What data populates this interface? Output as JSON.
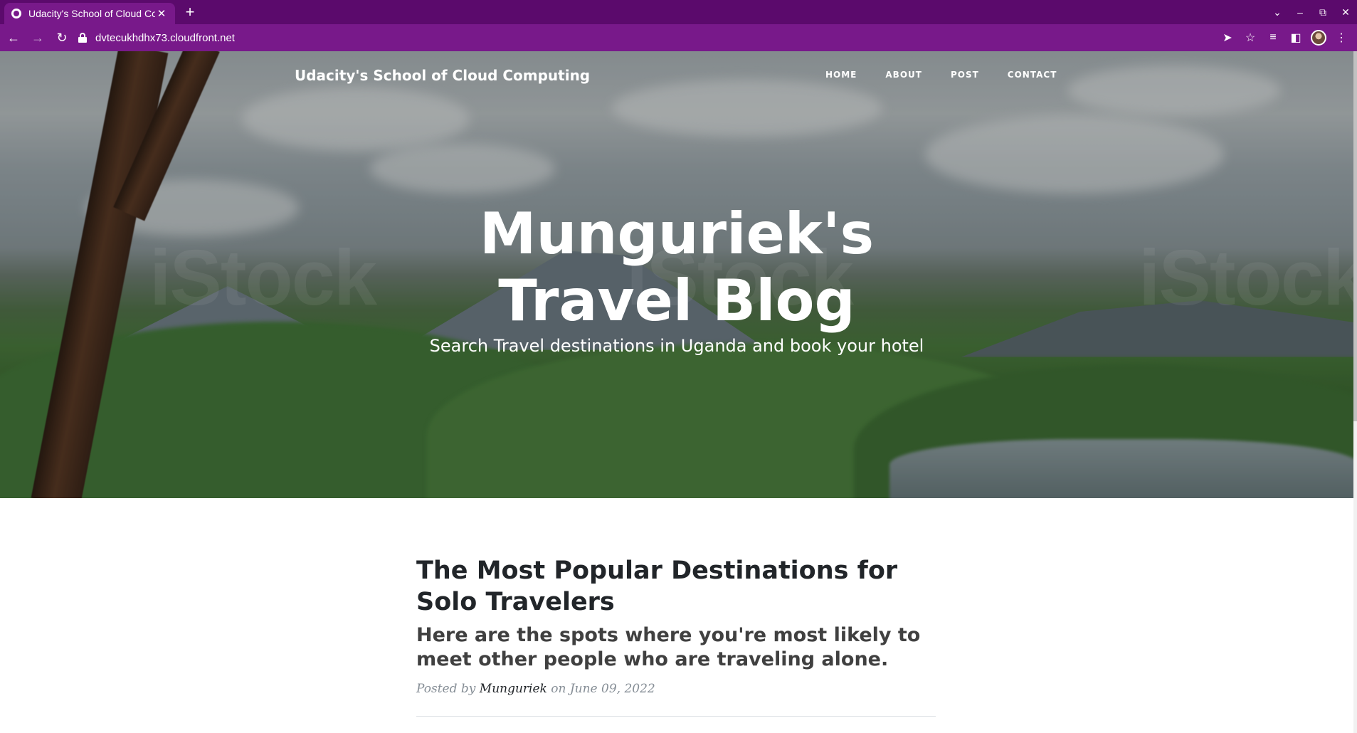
{
  "browser": {
    "tab_title": "Udacity's School of Cloud Cor",
    "tab_close": "✕",
    "new_tab": "+",
    "url": "dvtecukhdhx73.cloudfront.net",
    "controls": {
      "dropdown": "⌄",
      "minimize": "–",
      "restore": "⧉",
      "close": "✕"
    },
    "nav": {
      "back": "←",
      "forward": "→",
      "reload": "↻"
    },
    "toolbar_icons": {
      "send": "➤",
      "bookmark": "☆",
      "media": "≡",
      "sidepanel": "◧",
      "menu": "⋮"
    }
  },
  "site": {
    "brand": "Udacity's School of Cloud Computing",
    "nav": [
      "HOME",
      "ABOUT",
      "POST",
      "CONTACT"
    ]
  },
  "hero": {
    "title_line1": "Munguriek's",
    "title_line2": "Travel Blog",
    "subtitle": "Search Travel destinations in Uganda and book your hotel",
    "watermark": "iStock"
  },
  "post": {
    "title": "The Most Popular Destinations for Solo Travelers",
    "subtitle": "Here are the spots where you're most likely to meet other people who are traveling alone.",
    "meta_prefix": "Posted by ",
    "author": "Munguriek",
    "meta_suffix": " on June 09, 2022"
  }
}
